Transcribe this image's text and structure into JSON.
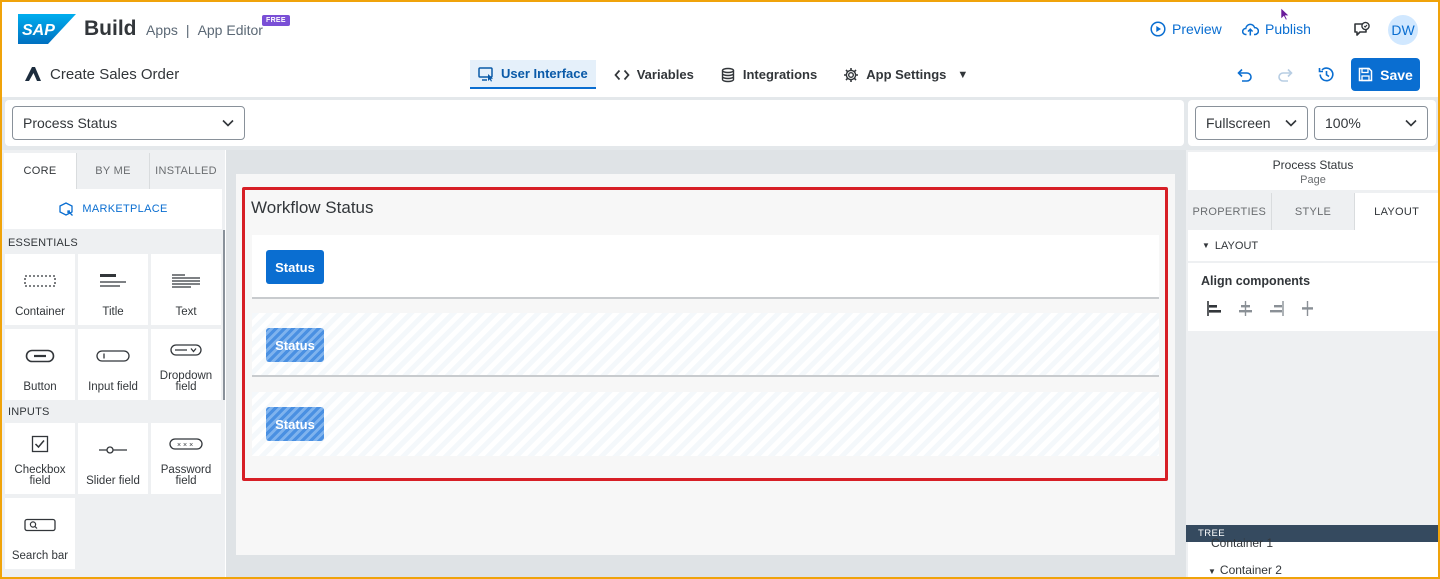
{
  "header": {
    "brand": "Build",
    "breadcrumb_apps": "Apps",
    "breadcrumb_sep": "|",
    "breadcrumb_editor": "App Editor",
    "badge": "FREE",
    "preview": "Preview",
    "publish": "Publish",
    "avatar_initials": "DW"
  },
  "app": {
    "title": "Create Sales Order"
  },
  "nav_tabs": [
    {
      "label": "User Interface",
      "icon": "monitor-cursor-icon",
      "active": true
    },
    {
      "label": "Variables",
      "icon": "code-brackets-icon",
      "active": false
    },
    {
      "label": "Integrations",
      "icon": "database-icon",
      "active": false
    },
    {
      "label": "App Settings",
      "icon": "gear-icon",
      "active": false
    }
  ],
  "actions": {
    "save": "Save"
  },
  "toolbar": {
    "page_select": "Process Status",
    "screen_select": "Fullscreen",
    "zoom_select": "100%"
  },
  "left_panel": {
    "tabs": [
      "CORE",
      "BY ME",
      "INSTALLED"
    ],
    "marketplace": "MARKETPLACE",
    "essentials_label": "ESSENTIALS",
    "inputs_label": "INPUTS",
    "essentials": [
      "Container",
      "Title",
      "Text",
      "Button",
      "Input field",
      "Dropdown field"
    ],
    "inputs": [
      "Checkbox field",
      "Slider field",
      "Password field",
      "Search bar"
    ]
  },
  "canvas": {
    "section_title": "Workflow Status",
    "status_buttons": [
      "Status",
      "Status",
      "Status"
    ]
  },
  "right_panel": {
    "page_name": "Process Status",
    "page_type": "Page",
    "tabs": [
      "PROPERTIES",
      "STYLE",
      "LAYOUT"
    ],
    "layout_section": "LAYOUT",
    "align_label": "Align components",
    "tree_label": "TREE",
    "tree_items": [
      "Container 1",
      "Container 2"
    ]
  },
  "colors": {
    "accent": "#0a6ed1",
    "selection_outline": "#d71f26",
    "frame_border": "#f0a30a",
    "badge": "#7a4fd6"
  }
}
